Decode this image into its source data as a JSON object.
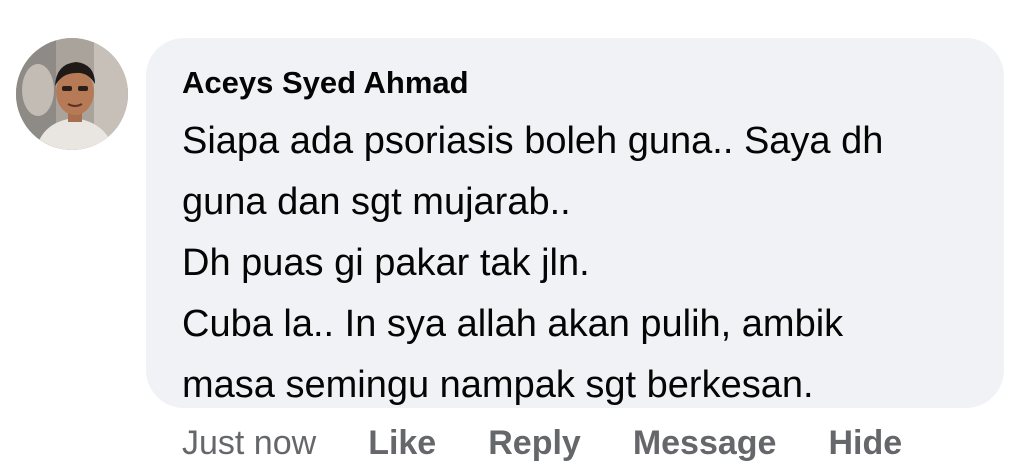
{
  "comment": {
    "author": "Aceys Syed Ahmad",
    "avatar_icon": "profile-photo-avatar",
    "lines": [
      "Siapa ada psoriasis boleh guna.. Saya dh",
      "guna dan sgt mujarab..",
      "Dh puas gi pakar tak jln.",
      "Cuba la.. In sya allah akan pulih, ambik",
      "masa semingu nampak sgt berkesan."
    ],
    "timestamp": "Just now",
    "actions": {
      "like": "Like",
      "reply": "Reply",
      "message": "Message",
      "hide": "Hide"
    }
  },
  "colors": {
    "bubble_background": "#f0f2f5",
    "text_primary": "#050505",
    "text_secondary": "#65676b"
  }
}
